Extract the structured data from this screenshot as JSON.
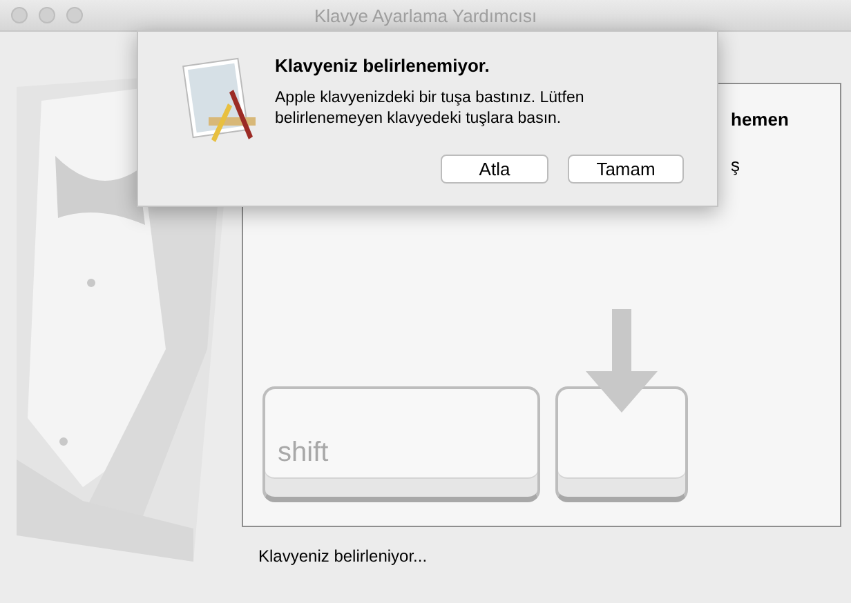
{
  "window": {
    "title": "Klavye Ayarlama Yardımcısı"
  },
  "panel": {
    "lines": [
      {
        "text": "hemen",
        "kind": "heading"
      },
      {
        "text": "ş",
        "kind": "body"
      }
    ],
    "keys": [
      {
        "kind": "wide",
        "label": "shift",
        "highlighted": false
      },
      {
        "kind": "blank",
        "highlighted": true
      }
    ]
  },
  "status": "Klavyeniz belirleniyor...",
  "dialog": {
    "title": "Klavyeniz belirlenemiyor.",
    "message": "Apple klavyenizdeki bir tuşa bastınız. Lütfen belirlenemeyen klavyedeki tuşlara basın.",
    "buttons": [
      "Atla",
      "Tamam"
    ]
  }
}
